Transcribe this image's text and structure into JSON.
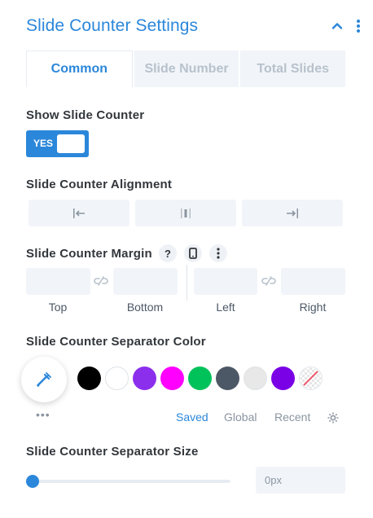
{
  "header": {
    "title": "Slide Counter Settings"
  },
  "tabs": [
    {
      "label": "Common",
      "active": true
    },
    {
      "label": "Slide Number",
      "active": false
    },
    {
      "label": "Total Slides",
      "active": false
    }
  ],
  "show_counter": {
    "label": "Show Slide Counter",
    "toggle_text": "YES",
    "enabled": true
  },
  "alignment": {
    "label": "Slide Counter Alignment",
    "options": [
      "align-left-icon",
      "align-center-icon",
      "align-right-icon"
    ]
  },
  "margin": {
    "label": "Slide Counter Margin",
    "help_glyph": "?",
    "fields": [
      {
        "caption": "Top",
        "value": ""
      },
      {
        "caption": "Bottom",
        "value": ""
      },
      {
        "caption": "Left",
        "value": ""
      },
      {
        "caption": "Right",
        "value": ""
      }
    ]
  },
  "separator_color": {
    "label": "Slide Counter Separator Color",
    "swatches": [
      "#000000",
      "#ffffff",
      "#8b2fed",
      "#ff00ff",
      "#00c25a",
      "#4c5866",
      "#e8e8e8",
      "#7a00e6",
      "none"
    ],
    "more_glyph": "•••",
    "palette_tabs": [
      {
        "label": "Saved",
        "active": true
      },
      {
        "label": "Global",
        "active": false
      },
      {
        "label": "Recent",
        "active": false
      }
    ]
  },
  "separator_size": {
    "label": "Slide Counter Separator Size",
    "value": "0px",
    "slider_fraction": 0
  },
  "colors": {
    "accent": "#2b87da",
    "field_bg": "#f1f5f9",
    "muted": "#8a95a1"
  }
}
